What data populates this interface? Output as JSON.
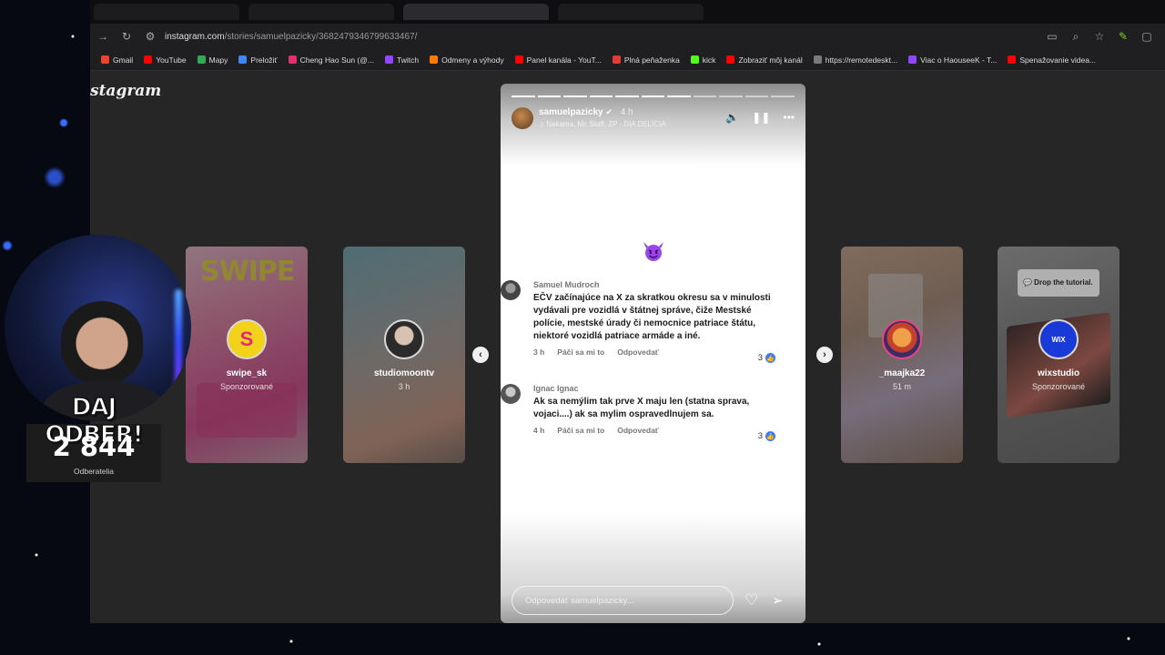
{
  "browser": {
    "url_host": "instagram.com",
    "url_path": "/stories/samuelpazicky/3682479346799633467/",
    "bookmarks": [
      {
        "label": "Gmail",
        "color": "#ea4335"
      },
      {
        "label": "YouTube",
        "color": "#ff0000"
      },
      {
        "label": "Mapy",
        "color": "#34a853"
      },
      {
        "label": "Preložiť",
        "color": "#4285f4"
      },
      {
        "label": "Cheng Hao Sun (@...",
        "color": "#e1306c"
      },
      {
        "label": "Twitch",
        "color": "#9146ff"
      },
      {
        "label": "Odmeny a výhody",
        "color": "#ff7a00"
      },
      {
        "label": "Panel kanála - YouT...",
        "color": "#ff0000"
      },
      {
        "label": "Plná peňaženka",
        "color": "#e53935"
      },
      {
        "label": "kick",
        "color": "#53fc18"
      },
      {
        "label": "Zobraziť môj kanál",
        "color": "#ff0000"
      },
      {
        "label": "https://remotedeskt...",
        "color": "#7a7a7a"
      },
      {
        "label": "Viac o HaouseeK - T...",
        "color": "#9146ff"
      },
      {
        "label": "Spenažovanie videa...",
        "color": "#ff0000"
      }
    ]
  },
  "instagram": {
    "logo": "stagram",
    "side_stories": [
      {
        "name": "swipe_sk",
        "sub": "Sponzorované"
      },
      {
        "name": "studiomoontv",
        "sub": "3 h"
      },
      {
        "name": "_maajka22",
        "sub": "51 m"
      },
      {
        "name": "wixstudio",
        "sub": "Sponzorované"
      }
    ],
    "story": {
      "username": "samuelpazicky",
      "time": "4 h",
      "music": "Nakama, Mc Staff, ZP · DIA DELÍCIA",
      "progress_total": 11,
      "progress_done": 7,
      "comments": [
        {
          "author": "Samuel Mudroch",
          "text": "EČV začínajúce na X za skratkou okresu sa v minulosti vydávali pre vozidlá v štátnej správe, čiže Mestské polície, mestské úrady či nemocnice patriace štátu, niektoré vozidlá patriace armáde a iné.",
          "time": "3 h",
          "like_label": "Páči sa mi to",
          "reply_label": "Odpovedať",
          "likes": "3"
        },
        {
          "author": "Ignac Ignac",
          "text": "Ak sa nemýlim tak prve X maju len (statna sprava, vojaci....)  ak sa mylim ospravedlnujem sa.",
          "time": "4 h",
          "like_label": "Páči sa mi to",
          "reply_label": "Odpovedať",
          "likes": "3"
        }
      ],
      "reply_placeholder": "Odpovedať samuelpazicky..."
    }
  },
  "overlay": {
    "cta": "DAJ ODBER!",
    "count": "2 844",
    "label": "Odberatelia"
  },
  "colors": {
    "accent_like": "#3f7bf0",
    "swipe_card": "#f26aa0",
    "page_bg": "#262626"
  }
}
